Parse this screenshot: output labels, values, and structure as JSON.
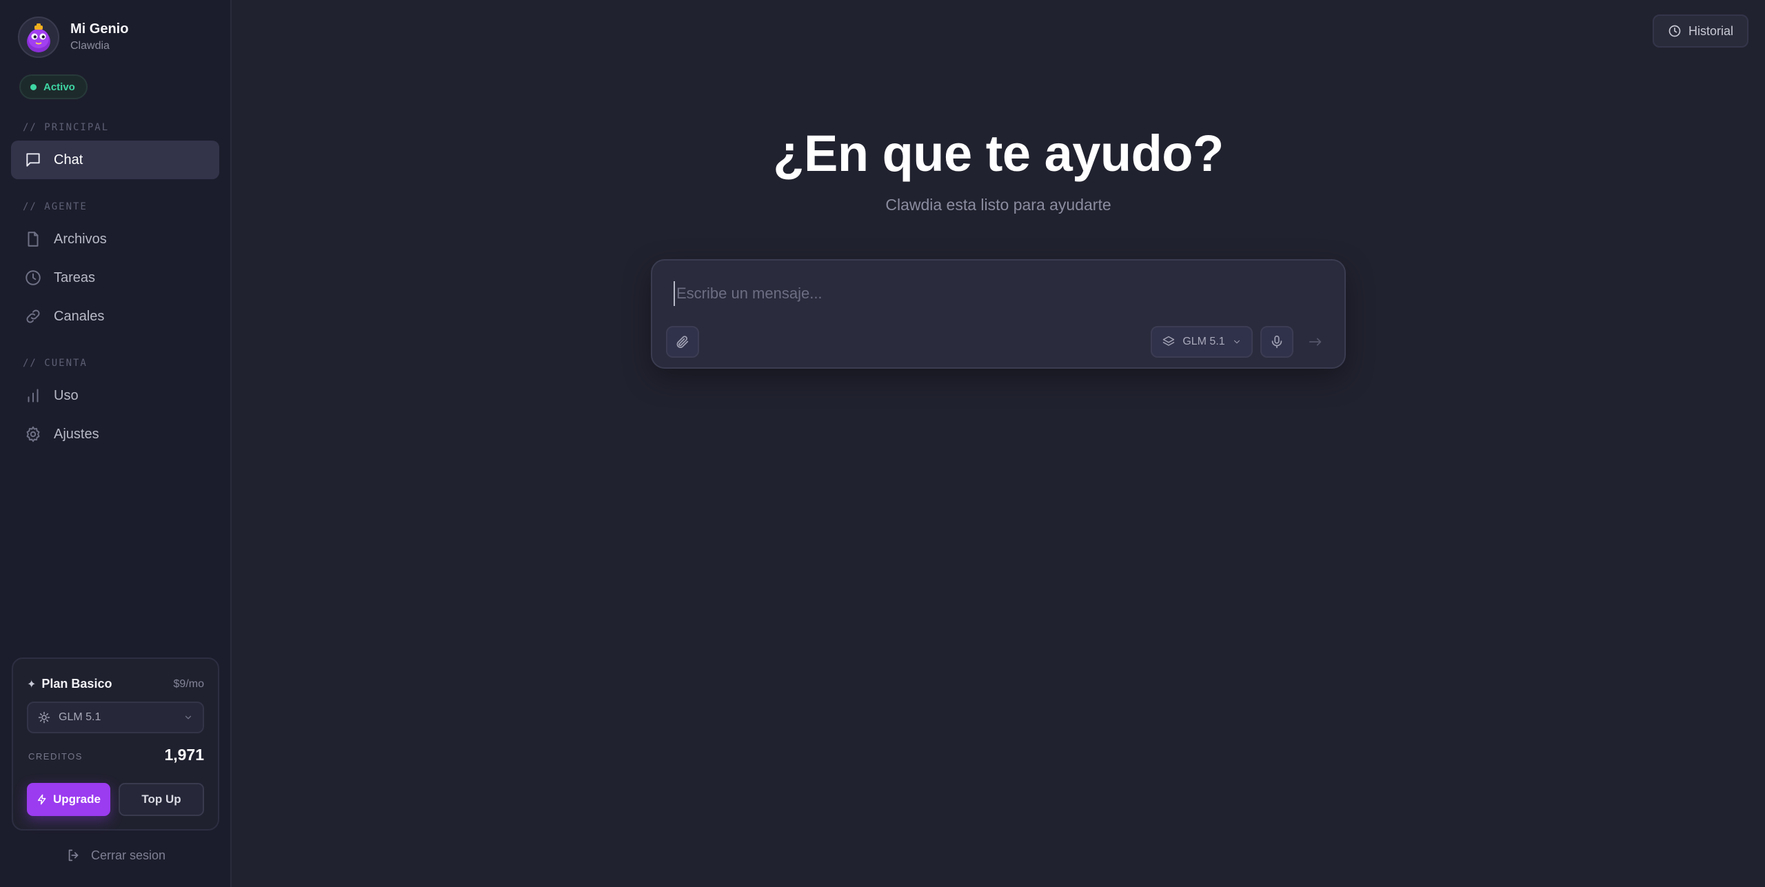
{
  "profile": {
    "name": "Mi Genio",
    "subtitle": "Clawdia"
  },
  "status": {
    "label": "Activo",
    "color": "#3ed6a3"
  },
  "sections": {
    "principal": "// PRINCIPAL",
    "agente": "// AGENTE",
    "cuenta": "// CUENTA"
  },
  "nav": {
    "chat": "Chat",
    "archivos": "Archivos",
    "tareas": "Tareas",
    "canales": "Canales",
    "uso": "Uso",
    "ajustes": "Ajustes"
  },
  "plan": {
    "name": "Plan Basico",
    "price": "$9/mo",
    "model": "GLM 5.1",
    "credits_label": "CREDITOS",
    "credits_value": "1,971",
    "upgrade_label": "Upgrade",
    "topup_label": "Top Up"
  },
  "logout_label": "Cerrar sesion",
  "header": {
    "history_label": "Historial"
  },
  "hero": {
    "title": "¿En que te ayudo?",
    "subtitle": "Clawdia esta listo para ayudarte"
  },
  "composer": {
    "placeholder": "Escribe un mensaje...",
    "value": "",
    "model": "GLM 5.1"
  },
  "colors": {
    "accent": "#9b3cf0",
    "background": "#21222f",
    "sidebar": "#1c1d2c"
  }
}
